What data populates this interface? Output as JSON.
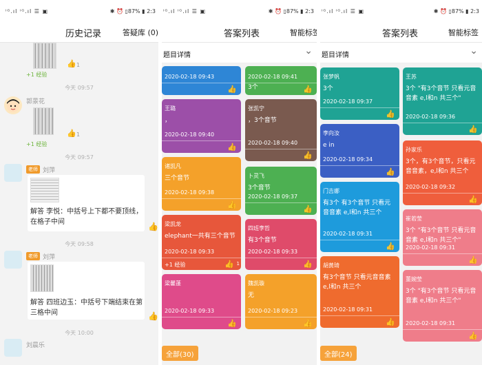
{
  "status": {
    "left": "ⁱᴳ.ıl ⁱᴳ.ıl ☰ ▣",
    "right": "✱ ⏰ ▯87% ▮ 2:3"
  },
  "history": {
    "title": "历史记录",
    "tab_label": "答疑库 (0)",
    "exp_label": "+1 经验",
    "thumb_count": "1",
    "times": [
      "今天 09:57",
      "今天 09:57",
      "今天 09:58",
      "今天 10:00"
    ],
    "users": [
      "郭景花",
      "刘萍",
      "刘萍",
      "刘晨乐"
    ],
    "teacher_badge": "老师",
    "answers": [
      "解答 李悦：中括号上下都不要顶线，在格子中间",
      "解答 四班边玉：中括号下端结束在第三格中间"
    ]
  },
  "answers_list": {
    "title": "答案列表",
    "tab_label": "智能标签",
    "sub_header": "题目详情",
    "all_label": "全部(30)",
    "exp_label": "+1 经验",
    "thumb_count": "1",
    "cards_left": [
      {
        "name": "",
        "text": "",
        "date": "2020-02-18 09:43",
        "color": "#2e86d6"
      },
      {
        "name": "王璐",
        "text": "，",
        "date": "2020-02-18 09:40",
        "color": "#9c4fa8"
      },
      {
        "name": "诸凯凡",
        "text": "三个音节",
        "date": "2020-02-18 09:38",
        "color": "#f4a12a"
      },
      {
        "name": "梁凯龙",
        "text": "elephant一共有三个音节",
        "date": "2020-02-18 09:33",
        "color": "#e7573b"
      },
      {
        "name": "梁馨蓬",
        "text": "",
        "date": "2020-02-18 09:33",
        "color": "#df4b8a"
      }
    ],
    "cards_right": [
      {
        "name": "",
        "text": "3个",
        "date": "2020-02-18 09:41",
        "color": "#4db052"
      },
      {
        "name": "张凯宁",
        "text": "，3个音节",
        "date": "2020-02-18 09:40",
        "color": "#7a5a4f"
      },
      {
        "name": "卜灵飞",
        "text": "3个音节",
        "date": "2020-02-18 09:37",
        "color": "#4db052"
      },
      {
        "name": "四班李哲",
        "text": "有3个音节",
        "date": "2020-02-18 09:33",
        "color": "#df4b6a"
      },
      {
        "name": "魏凯璇",
        "text": "无",
        "date": "2020-02-18 09:23",
        "color": "#f4a12a"
      }
    ]
  },
  "answers_list2": {
    "title": "答案列表",
    "tab_label": "智能标签",
    "sub_header": "题目详情",
    "all_label": "全部(24)",
    "cards_left": [
      {
        "name": "张梦帆",
        "text": "3个",
        "date": "2020-02-18 09:37",
        "color": "#1fa394"
      },
      {
        "name": "李向汝",
        "text": "e in",
        "date": "2020-02-18 09:34",
        "color": "#3b5fc4"
      },
      {
        "name": "门吉娜",
        "text": "有3个 有3个音节 只看元音音素 e,l和n 共三个",
        "date": "2020-02-18 09:31",
        "color": "#1e9bdc"
      },
      {
        "name": "胡黄琦",
        "text": "有3个音节 只看元音音素 e,l和n 共三个",
        "date": "2020-02-18 09:31",
        "color": "#ef6b2e"
      }
    ],
    "cards_right": [
      {
        "name": "王苏",
        "text": "3个 \"有3个音节 只看元音音素 e,l和n 共三个\"",
        "date": "2020-02-18 09:36",
        "color": "#1fa394"
      },
      {
        "name": "孙家乐",
        "text": "3个，有3个音节，只看元音音素，e,l和n 共三个",
        "date": "2020-02-18 09:32",
        "color": "#ef5e3c"
      },
      {
        "name": "崔若莹",
        "text": "3个 \"有3个音节 只看元音音素 e,l和n 共三个\"",
        "date": "2020-02-18 09:31",
        "color": "#ef7d8a"
      },
      {
        "name": "董婉莹",
        "text": "3个 \"有3个音节 只看元音音素 e,l和n 共三个\"",
        "date": "2020-02-18 09:31",
        "color": "#ef7d8a"
      }
    ]
  }
}
